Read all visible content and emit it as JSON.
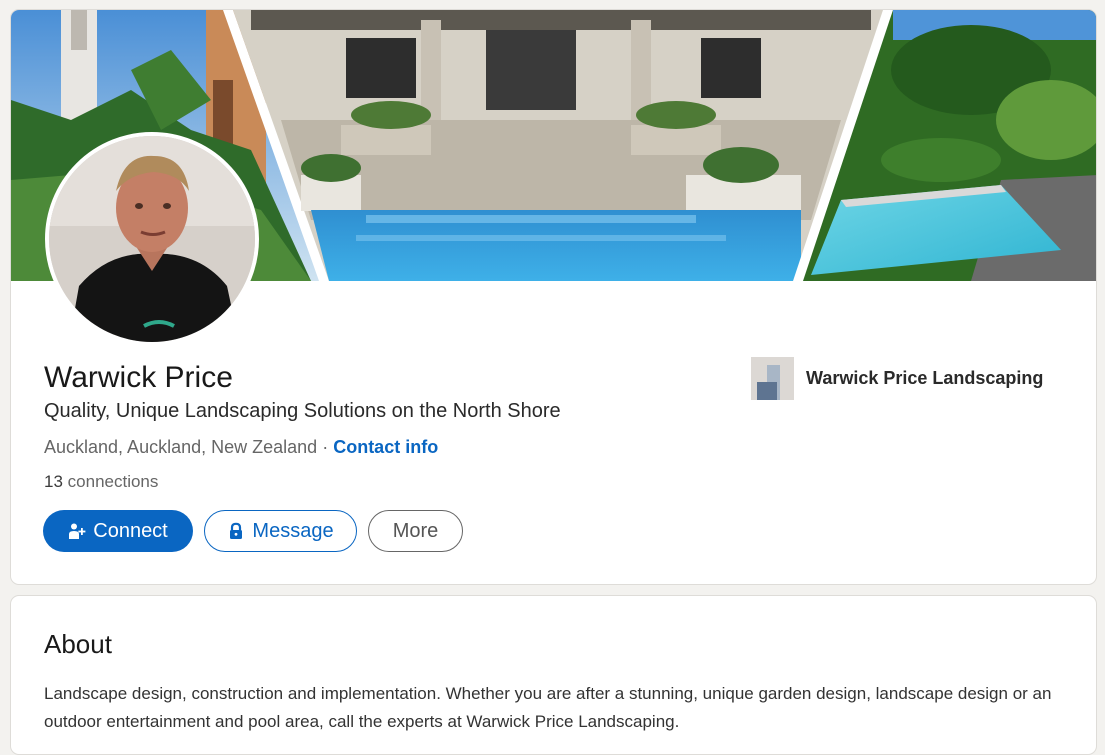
{
  "profile": {
    "name": "Warwick Price",
    "headline": "Quality, Unique Landscaping Solutions on the North Shore",
    "location": "Auckland, Auckland, New Zealand",
    "separator": "·",
    "contact_info_label": "Contact info",
    "connections_count": "13",
    "connections_label": "connections"
  },
  "actions": {
    "connect_label": "Connect",
    "message_label": "Message",
    "more_label": "More"
  },
  "company": {
    "name": "Warwick Price Landscaping"
  },
  "about": {
    "title": "About",
    "text": "Landscape design, construction and implementation. Whether you are after a stunning, unique garden design, landscape design or an outdoor entertainment and pool area, call the experts at Warwick Price Landscaping."
  },
  "icons": {
    "connect": "person-add-icon",
    "message": "lock-icon"
  },
  "colors": {
    "accent": "#0a66c2",
    "page_background": "#f3f2ef",
    "card_background": "#ffffff"
  }
}
